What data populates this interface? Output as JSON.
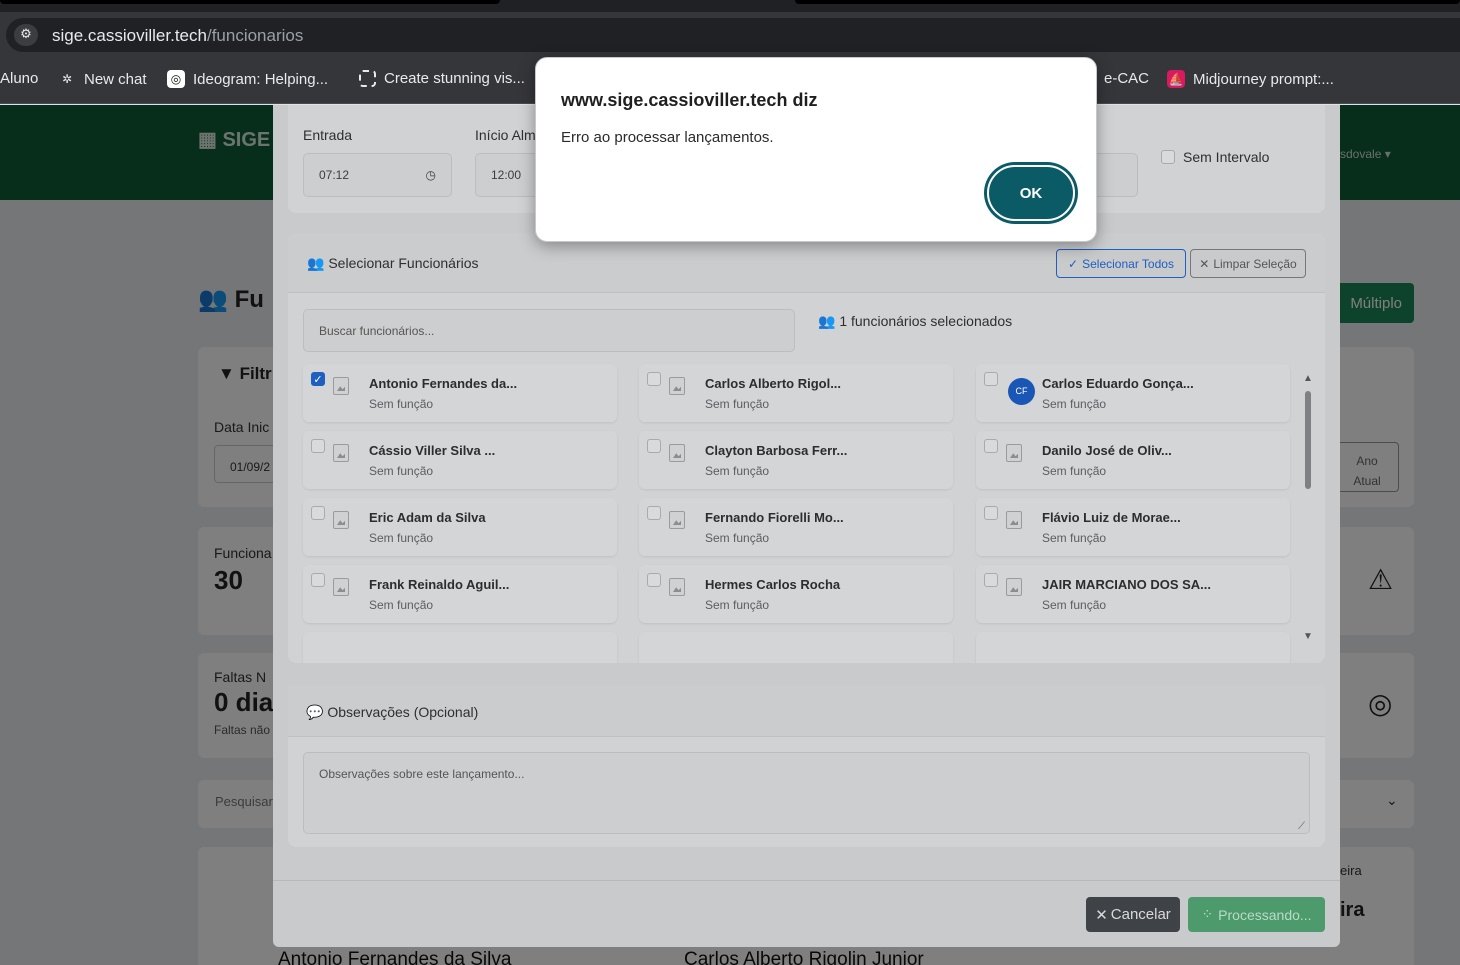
{
  "browser": {
    "site_info_icon": "site-settings-icon",
    "url_host": "sige.cassioviller.tech",
    "url_path": "/funcionarios",
    "bookmarks": [
      {
        "label": "Aluno",
        "icon": ""
      },
      {
        "label": "New chat",
        "icon": "openai-icon"
      },
      {
        "label": "Ideogram: Helping...",
        "icon": "ideogram-icon"
      },
      {
        "label": "Create stunning vis...",
        "icon": "frame-icon"
      },
      {
        "label": "e-CAC",
        "icon": ""
      },
      {
        "label": "Midjourney prompt:...",
        "icon": "midjourney-icon"
      }
    ]
  },
  "app": {
    "brand": "SIGE -",
    "user": "sdovale",
    "page_title": "Fu",
    "multiplo_button": "Múltiplo",
    "filter_title": "Filtr",
    "data_inicio_label": "Data Inic",
    "data_inicio_value": "01/09/2",
    "ano_atual_line1": "Ano",
    "ano_atual_line2": "Atual",
    "funcionarios_label": "Funciona",
    "funcionarios_count": "30",
    "faltas_label": "Faltas N",
    "faltas_value": "0 dia",
    "faltas_sub": "Faltas não",
    "pesquisar_placeholder": "Pesquisar",
    "bottom_card_1": "Antonio Fernandes da Silva",
    "bottom_card_2": "Carlos Alberto Rigolin Junior",
    "right_text_1": "eira",
    "right_text_2": "ira"
  },
  "modal": {
    "entrada_label": "Entrada",
    "entrada_value": "07:12",
    "inicio_label": "Início Alm",
    "inicio_value": "12:00",
    "sem_intervalo_label": "Sem Intervalo",
    "select_title": "Selecionar Funcionários",
    "select_all_button": "Selecionar Todos",
    "clear_button": "Limpar Seleção",
    "search_placeholder": "Buscar funcionários...",
    "selected_count": "1 funcionários selecionados",
    "employees": [
      {
        "name": "Antonio Fernandes da...",
        "role": "Sem função",
        "checked": true,
        "initials": ""
      },
      {
        "name": "Carlos Alberto Rigol...",
        "role": "Sem função",
        "checked": false,
        "initials": ""
      },
      {
        "name": "Carlos Eduardo Gonça...",
        "role": "Sem função",
        "checked": false,
        "initials": "CF"
      },
      {
        "name": "Cássio Viller Silva ...",
        "role": "Sem função",
        "checked": false,
        "initials": ""
      },
      {
        "name": "Clayton Barbosa Ferr...",
        "role": "Sem função",
        "checked": false,
        "initials": ""
      },
      {
        "name": "Danilo José de Oliv...",
        "role": "Sem função",
        "checked": false,
        "initials": ""
      },
      {
        "name": "Eric Adam da Silva",
        "role": "Sem função",
        "checked": false,
        "initials": ""
      },
      {
        "name": "Fernando Fiorelli Mo...",
        "role": "Sem função",
        "checked": false,
        "initials": ""
      },
      {
        "name": "Flávio Luiz de Morae...",
        "role": "Sem função",
        "checked": false,
        "initials": ""
      },
      {
        "name": "Frank Reinaldo Aguil...",
        "role": "Sem função",
        "checked": false,
        "initials": ""
      },
      {
        "name": "Hermes Carlos Rocha",
        "role": "Sem função",
        "checked": false,
        "initials": ""
      },
      {
        "name": "JAIR MARCIANO DOS SA...",
        "role": "Sem função",
        "checked": false,
        "initials": ""
      }
    ],
    "obs_title": "Observações (Opcional)",
    "obs_placeholder": "Observações sobre este lançamento...",
    "cancel_button": "Cancelar",
    "processing_button": "Processando..."
  },
  "alert": {
    "title": "www.sige.cassioviller.tech diz",
    "message": "Erro ao processar lançamentos.",
    "ok_button": "OK"
  },
  "colors": {
    "appbar": "#0f5a36",
    "primary_outline": "#1f5fbf",
    "success": "#198754",
    "dialog_button": "#0b5b67"
  }
}
